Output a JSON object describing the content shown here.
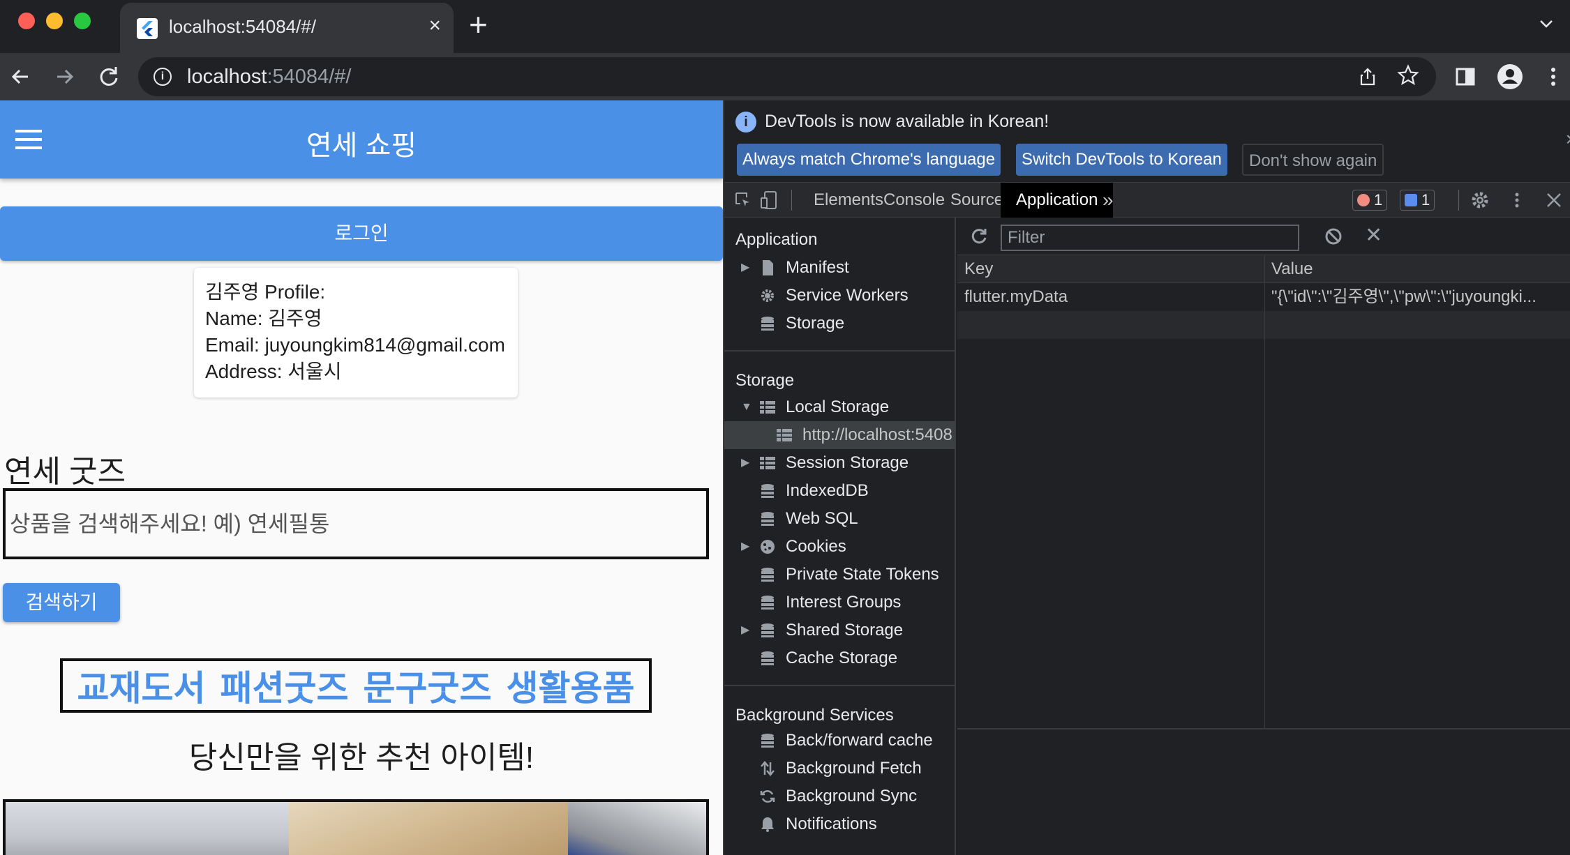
{
  "browser": {
    "tab_title": "localhost:54084/#/",
    "tab_close": "×",
    "new_tab": "+",
    "url_host": "localhost",
    "url_rest": ":54084/#/"
  },
  "app": {
    "title": "연세 쇼핑",
    "login_label": "로그인",
    "profile": {
      "line1": "김주영 Profile:",
      "line2": "Name: 김주영",
      "line3": "Email: juyoungkim814@gmail.com",
      "line4": "Address: 서울시"
    },
    "section_title": "연세 굿즈",
    "search_placeholder": "상품을 검색해주세요! 예) 연세필통",
    "search_button": "검색하기",
    "categories": [
      "교재도서",
      "패션굿즈",
      "문구굿즈",
      "생활용품"
    ],
    "recommend_title": "당신만을 위한 추천 아이템!"
  },
  "devtools": {
    "info_text": "DevTools is now available in Korean!",
    "btn_match": "Always match Chrome's language",
    "btn_switch": "Switch DevTools to Korean",
    "btn_dont": "Don't show again",
    "tabs": {
      "elements": "Elements",
      "console": "Console",
      "sources": "Sources",
      "application": "Application",
      "more": "»"
    },
    "error_count": "1",
    "message_count": "1",
    "sidebar": {
      "application_header": "Application",
      "manifest": "Manifest",
      "service_workers": "Service Workers",
      "storage": "Storage",
      "storage_header": "Storage",
      "local_storage": "Local Storage",
      "local_storage_origin": "http://localhost:5408",
      "session_storage": "Session Storage",
      "indexeddb": "IndexedDB",
      "web_sql": "Web SQL",
      "cookies": "Cookies",
      "private_state_tokens": "Private State Tokens",
      "interest_groups": "Interest Groups",
      "shared_storage": "Shared Storage",
      "cache_storage": "Cache Storage",
      "background_header": "Background Services",
      "bfcache": "Back/forward cache",
      "background_fetch": "Background Fetch",
      "background_sync": "Background Sync",
      "notifications": "Notifications"
    },
    "filter_placeholder": "Filter",
    "grid": {
      "key_header": "Key",
      "value_header": "Value",
      "rows": [
        {
          "key": "flutter.myData",
          "value": "\"{\\\"id\\\":\\\"김주영\\\",\\\"pw\\\":\\\"juyoungki..."
        }
      ]
    }
  }
}
